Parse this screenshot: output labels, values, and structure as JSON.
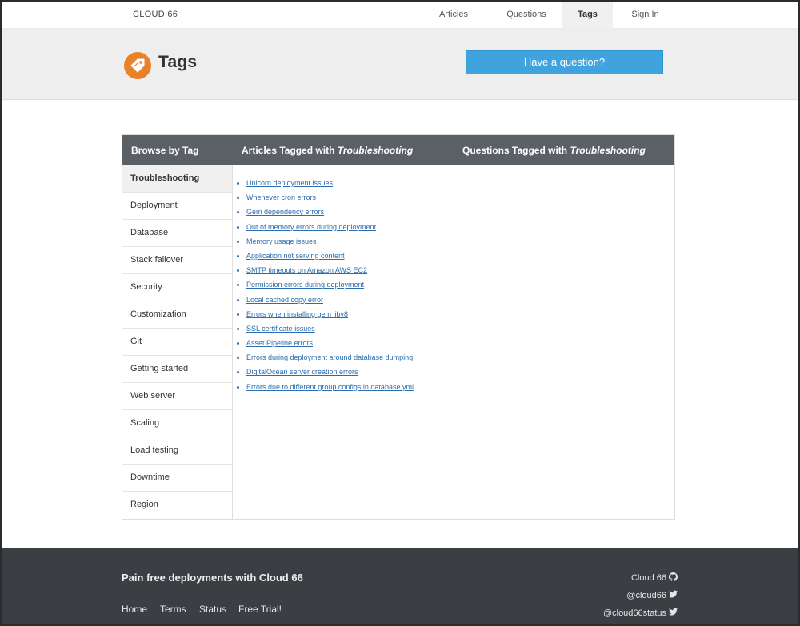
{
  "brand": "CLOUD 66",
  "nav": [
    {
      "label": "Articles"
    },
    {
      "label": "Questions"
    },
    {
      "label": "Tags"
    },
    {
      "label": "Sign In"
    }
  ],
  "header": {
    "title": "Tags",
    "ask_button": "Have a question?",
    "icon": "tag-icon"
  },
  "panel": {
    "browse_heading": "Browse by Tag",
    "articles_heading_prefix": "Articles Tagged with ",
    "questions_heading_prefix": "Questions Tagged with ",
    "selected_tag": "Troubleshooting",
    "tags": [
      "Troubleshooting",
      "Deployment",
      "Database",
      "Stack failover",
      "Security",
      "Customization",
      "Git",
      "Getting started",
      "Web server",
      "Scaling",
      "Load testing",
      "Downtime",
      "Region"
    ],
    "articles": [
      "Unicorn deployment issues",
      "Whenever cron errors",
      "Gem dependency errors",
      "Out of memory errors during deployment",
      "Memory usage issues",
      "Application not serving content",
      "SMTP timeouts on Amazon AWS EC2",
      "Permission errors during deployment",
      "Local cached copy error",
      "Errors when installing gem libv8",
      "SSL certificate issues",
      "Asset Pipeline errors",
      "Errors during deployment around database dumping",
      "DigitalOcean server creation errors",
      "Errors due to different group configs in database.yml"
    ]
  },
  "footer": {
    "tagline": "Pain free deployments with Cloud 66",
    "links": [
      "Home",
      "Terms",
      "Status",
      "Free Trial!"
    ],
    "social": [
      {
        "label": "Cloud 66",
        "icon": "github-icon"
      },
      {
        "label": "@cloud66",
        "icon": "twitter-icon"
      },
      {
        "label": "@cloud66status",
        "icon": "twitter-icon"
      }
    ]
  },
  "colors": {
    "accent": "#3fa4de",
    "tag_logo": "#e9802a",
    "panel_header": "#5a6066",
    "footer": "#3b3f44",
    "link": "#2a6db0"
  }
}
